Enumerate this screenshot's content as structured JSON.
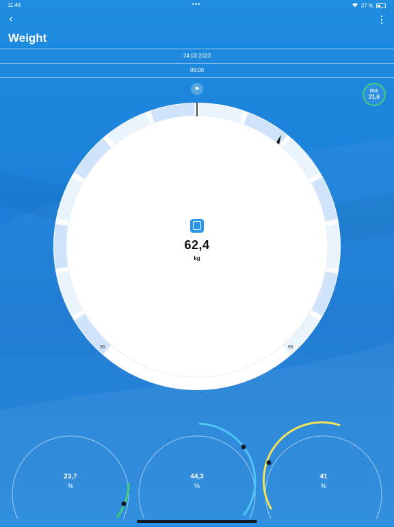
{
  "status": {
    "time": "11:46",
    "dots": "•••",
    "battery": "37 %"
  },
  "header": {
    "title": "Weight",
    "back_icon": "chevron-left-icon",
    "menu_icon": "more-vertical-icon"
  },
  "entry": {
    "date": "24.03.2023",
    "time": "09:00"
  },
  "goal_icon": "flag-icon",
  "bmi": {
    "label": "BMI",
    "value": "21,6",
    "color": "#3fcf7a"
  },
  "weight": {
    "value": "62,4",
    "unit": "kg",
    "scale_min": "56",
    "scale_max": "66"
  },
  "gauges": [
    {
      "value": "23,7",
      "unit": "%",
      "color": "#3fcf7a"
    },
    {
      "value": "44,3",
      "unit": "%",
      "color": "#4fc6f2"
    },
    {
      "value": "41",
      "unit": "%",
      "color": "#f4e35a"
    }
  ]
}
